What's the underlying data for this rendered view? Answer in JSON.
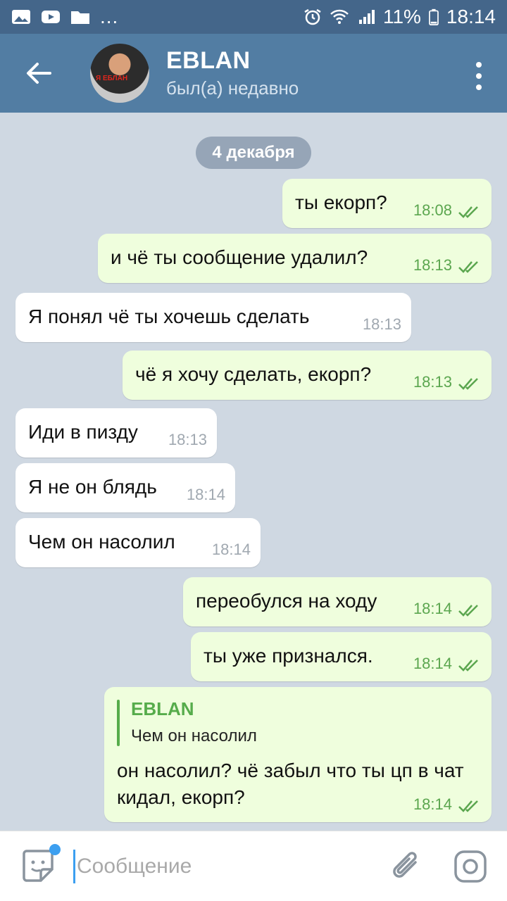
{
  "status_bar": {
    "overflow": "...",
    "battery": "11%",
    "time": "18:14"
  },
  "header": {
    "title": "EBLAN",
    "subtitle": "был(а) недавно",
    "avatar_caption": "Я ЕБЛАН"
  },
  "chat": {
    "date": "4 декабря",
    "messages": [
      {
        "dir": "out",
        "text": "ты екорп?",
        "time": "18:08"
      },
      {
        "dir": "out",
        "text": "и чё ты сообщение удалил?",
        "time": "18:13"
      },
      {
        "dir": "in",
        "text": "Я понял чё ты хочешь сделать",
        "time": "18:13"
      },
      {
        "dir": "out",
        "text": "чё я хочу сделать, екорп?",
        "time": "18:13"
      },
      {
        "dir": "in",
        "text": "Иди в пизду",
        "time": "18:13"
      },
      {
        "dir": "in",
        "text": "Я не он блядь",
        "time": "18:14"
      },
      {
        "dir": "in",
        "text": "Чем он насолил",
        "time": "18:14"
      },
      {
        "dir": "out",
        "text": "переобулся на ходу",
        "time": "18:14"
      },
      {
        "dir": "out",
        "text": "ты уже признался.",
        "time": "18:14"
      },
      {
        "dir": "out",
        "reply_name": "EBLAN",
        "reply_text": "Чем он насолил",
        "text": "он насолил? чё забыл что ты цп в чат кидал, екорп?",
        "time": "18:14"
      }
    ]
  },
  "input": {
    "placeholder": "Сообщение"
  },
  "colors": {
    "header": "#527da3",
    "status_bar": "#44668a",
    "outgoing_bubble": "#effedd",
    "incoming_bubble": "#ffffff",
    "accent_green": "#56ac4b",
    "cursor_blue": "#3c9ff0"
  }
}
